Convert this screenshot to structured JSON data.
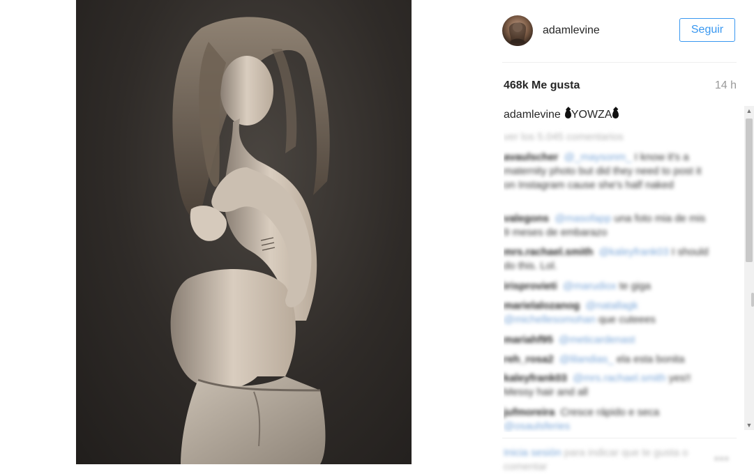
{
  "post": {
    "username": "adamlevine",
    "follow_label": "Seguir",
    "likes": "468k Me gusta",
    "time": "14 h",
    "caption_user": "adamlevine",
    "caption_text": "YOWZA",
    "view_all": "ver los 5.045 comentarios"
  },
  "comments": [
    {
      "user": "avaulscher",
      "mention": "@_maysonm_",
      "text": "I know it's a maternity photo but did they need to post it on Instagram cause she's half naked"
    },
    {
      "user": "valegons",
      "mention": "@masofapp",
      "text": "una foto mia de mis 9 meses de embarazo"
    },
    {
      "user": "mrs.rachael.smith",
      "mention": "@kaleyfrank03",
      "text": "I should do this. Lol."
    },
    {
      "user": "irisprovieti",
      "mention": "@marudiox",
      "text": "te giga"
    },
    {
      "user": "marielalozanog",
      "mention": "@natallagk @michellesomohan",
      "text": "que cuteees"
    },
    {
      "user": "mariahf95",
      "mention": "@meticardenast",
      "text": ""
    },
    {
      "user": "reh_rosa2",
      "mention": "@lilandias_",
      "text": "ela esta bonita"
    },
    {
      "user": "kaleyfrank03",
      "mention": "@mrs.rachael.smith",
      "text": "yes!! Messy hair and all"
    },
    {
      "user": "jufmoreira",
      "mention": "@osaulsferies",
      "text": "Cresce rápido e seca"
    }
  ],
  "footer": {
    "login_link": "Inicia sesión",
    "login_text": "para indicar que te gusta o comentar"
  },
  "colors": {
    "accent": "#3897f0",
    "text": "#262626",
    "muted": "#999999"
  },
  "icons": {
    "caption_emoji": "droplet-icon",
    "scroll_up": "arrow-up-icon",
    "scroll_down": "arrow-down-icon",
    "more": "ellipsis-icon"
  }
}
